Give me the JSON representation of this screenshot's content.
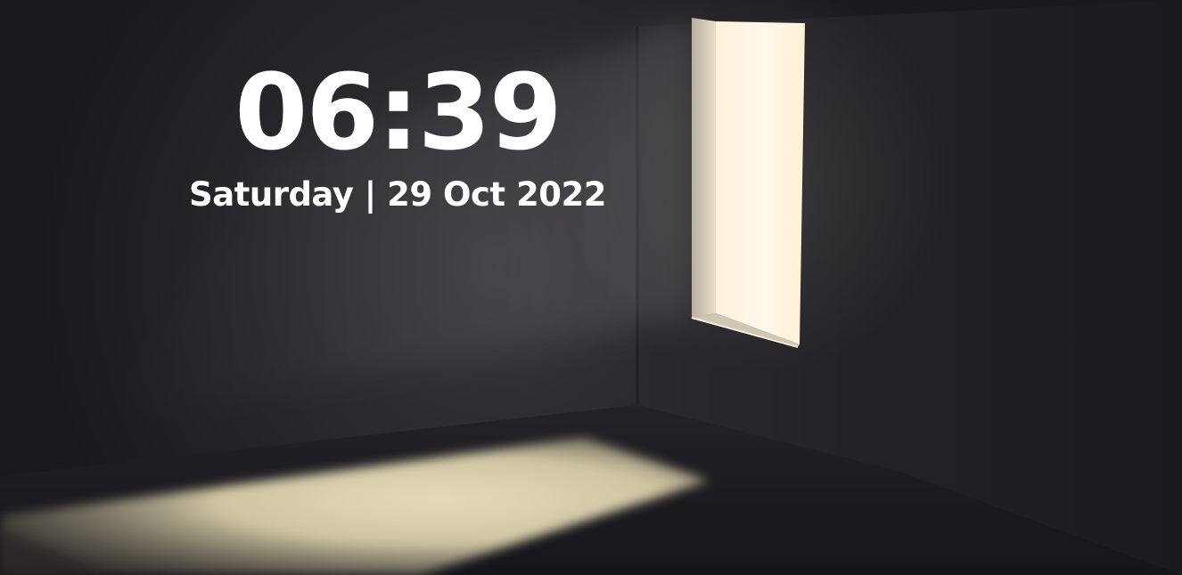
{
  "lock_screen": {
    "time": "06:39",
    "date": "Saturday | 29 Oct 2022"
  },
  "wallpaper": {
    "subject": "dark room lit by light from a doorway",
    "colors": {
      "wall": "#1e1d21",
      "doorway_light": "#fff4df",
      "floor_light": "#ece2bd"
    }
  }
}
